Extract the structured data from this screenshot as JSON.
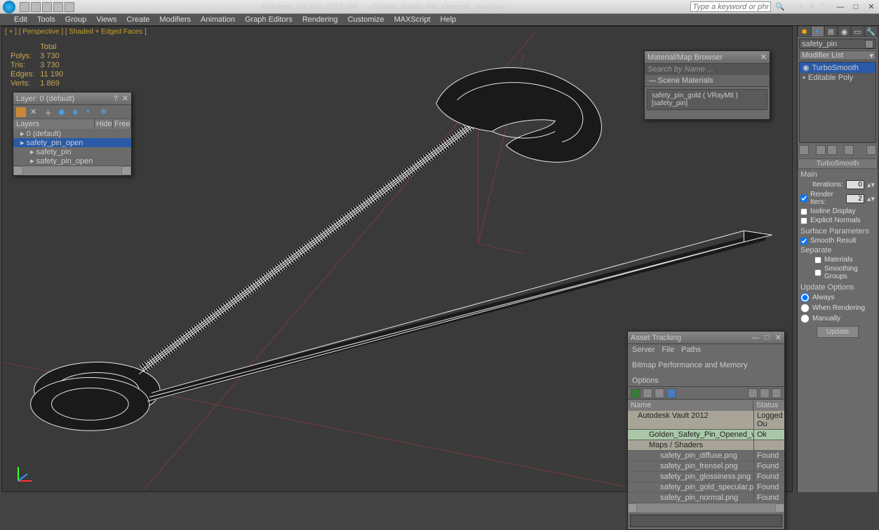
{
  "title": {
    "app": "Autodesk 3ds Max  2012 x64",
    "file": "Golden_Safety_Pin_Opened_vray.max"
  },
  "search_placeholder": "Type a keyword or phrase",
  "menus": [
    "Edit",
    "Tools",
    "Group",
    "Views",
    "Create",
    "Modifiers",
    "Animation",
    "Graph Editors",
    "Rendering",
    "Customize",
    "MAXScript",
    "Help"
  ],
  "viewport_label": "[ + ]  [ Perspective ]  [ Shaded + Edged Faces ]",
  "stats": {
    "header": "Total",
    "rows": [
      [
        "Polys:",
        "3 730"
      ],
      [
        "Tris:",
        "3 730"
      ],
      [
        "Edges:",
        "11 190"
      ],
      [
        "Verts:",
        "1 869"
      ]
    ]
  },
  "layer": {
    "title": "Layer: 0 (default)",
    "cols": [
      "Layers",
      "Hide",
      "Free"
    ],
    "rows": [
      {
        "name": "0 (default)",
        "indent": 0,
        "sel": false
      },
      {
        "name": "safety_pin_open",
        "indent": 0,
        "sel": true
      },
      {
        "name": "safety_pin",
        "indent": 1,
        "sel": false
      },
      {
        "name": "safety_pin_open",
        "indent": 1,
        "sel": false
      }
    ]
  },
  "material": {
    "title": "Material/Map Browser",
    "search": "Search by Name ...",
    "group": "Scene Materials",
    "item": "safety_pin_gold  ( VRayMtl ) [safety_pin]"
  },
  "asset": {
    "title": "Asset Tracking",
    "menus": [
      "Server",
      "File",
      "Paths",
      "Bitmap Performance and Memory",
      "Options"
    ],
    "cols": [
      "Name",
      "Status"
    ],
    "rows": [
      {
        "name": "Autodesk Vault 2012",
        "status": "Logged Ou",
        "type": "hd",
        "indent": 0
      },
      {
        "name": "Golden_Safety_Pin_Opened_vray.max",
        "status": "Ok",
        "type": "ok",
        "indent": 1
      },
      {
        "name": "Maps / Shaders",
        "status": "",
        "type": "hd",
        "indent": 1
      },
      {
        "name": "safety_pin_diffuse.png",
        "status": "Found",
        "type": "dat",
        "indent": 2
      },
      {
        "name": "safety_pin_frensel.png",
        "status": "Found",
        "type": "dat",
        "indent": 2
      },
      {
        "name": "safety_pin_glossiness.png",
        "status": "Found",
        "type": "dat",
        "indent": 2
      },
      {
        "name": "safety_pin_gold_specular.png",
        "status": "Found",
        "type": "dat",
        "indent": 2
      },
      {
        "name": "safety_pin_normal.png",
        "status": "Found",
        "type": "dat",
        "indent": 2
      }
    ]
  },
  "cmd": {
    "objname": "safety_pin",
    "modlist": "Modifier List",
    "stack": [
      {
        "name": "TurboSmooth",
        "sel": true
      },
      {
        "name": "Editable Poly",
        "sel": false
      }
    ],
    "roll_title": "TurboSmooth",
    "main": "Main",
    "iterations_lbl": "Iterations:",
    "iterations": "0",
    "render_iters_lbl": "Render Iters:",
    "render_iters": "2",
    "isoline": "Isoline Display",
    "explicit": "Explicit Normals",
    "surf": "Surface Parameters",
    "smooth": "Smooth Result",
    "sep": "Separate",
    "mats": "Materials",
    "sg": "Smoothing Groups",
    "upd": "Update Options",
    "always": "Always",
    "when": "When Rendering",
    "man": "Manually",
    "update_btn": "Update"
  }
}
